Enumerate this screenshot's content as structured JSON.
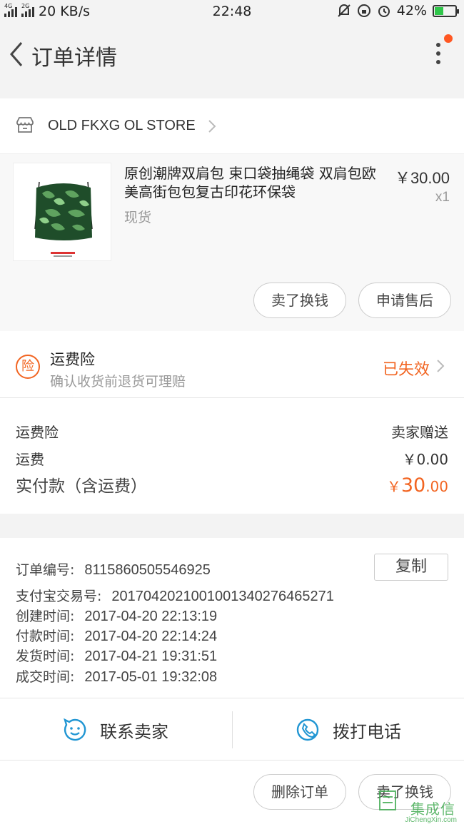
{
  "status_bar": {
    "network_label": "4G",
    "network2_label": "2G",
    "speed": "20 KB/s",
    "time": "22:48",
    "battery": "42%",
    "battery_fraction": 0.42
  },
  "nav": {
    "title": "订单详情"
  },
  "store": {
    "name": "OLD FKXG OL STORE"
  },
  "product": {
    "title": "原创潮牌双肩包 束口袋抽绳袋 双肩包欧美高街包包复古印花环保袋",
    "stock": "现货",
    "price": "￥30.00",
    "qty": "x1",
    "sell_btn": "卖了换钱",
    "aftersale_btn": "申请售后"
  },
  "insurance": {
    "badge": "险",
    "title": "运费险",
    "subtitle": "确认收货前退货可理赔",
    "status": "已失效"
  },
  "fees": {
    "ins_label": "运费险",
    "ins_value": "卖家赠送",
    "ship_label": "运费",
    "ship_value": "￥0.00",
    "total_label": "实付款（含运费）",
    "total_symbol": "￥",
    "total_int": "30",
    "total_dec": ".00"
  },
  "order_info": {
    "order_no_label": "订单编号:",
    "order_no": "8115860505546925",
    "copy_btn": "复制",
    "alipay_label": "支付宝交易号:",
    "alipay_no": "2017042021001001340276465271",
    "created_label": "创建时间:",
    "created": "2017-04-20 22:13:19",
    "paid_label": "付款时间:",
    "paid": "2017-04-20 22:14:24",
    "shipped_label": "发货时间:",
    "shipped": "2017-04-21 19:31:51",
    "done_label": "成交时间:",
    "done": "2017-05-01 19:32:08"
  },
  "actions": {
    "contact_seller": "联系卖家",
    "call": "拨打电话"
  },
  "bottom": {
    "delete_btn": "删除订单",
    "sell_btn": "卖了换钱"
  },
  "watermark": {
    "text": "集成信",
    "url": "JiChengXin.com"
  },
  "colors": {
    "accent": "#f26522",
    "icon_blue": "#2196d3",
    "battery_green": "#2fc64a"
  }
}
